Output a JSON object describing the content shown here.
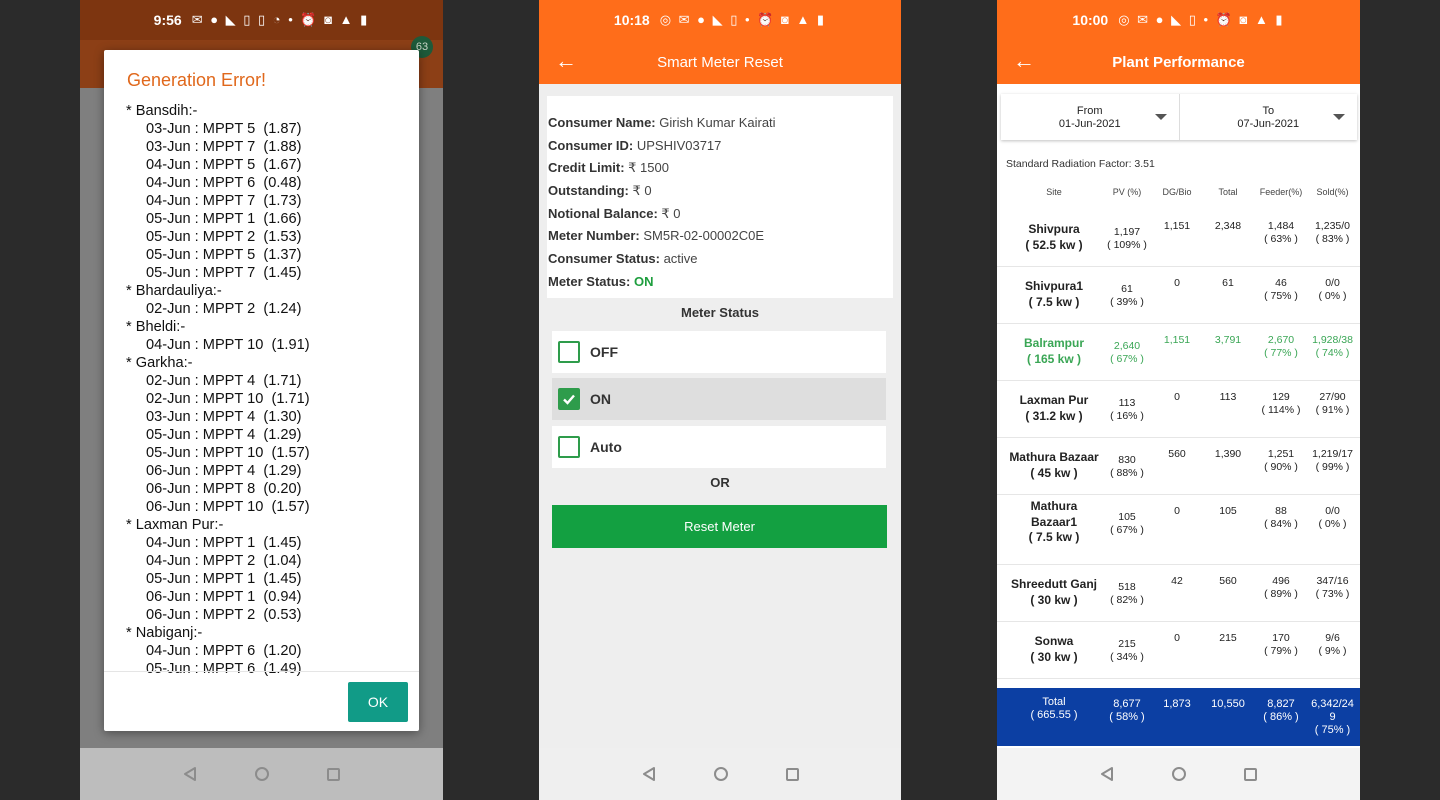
{
  "phone1": {
    "status_time": "9:56",
    "badge": "63",
    "dialog": {
      "title": "Generation Error!",
      "ok_label": "OK",
      "sections": [
        {
          "site": "* Bansdih:-",
          "entries": [
            "03-Jun : MPPT 5  (1.87)",
            "03-Jun : MPPT 7  (1.88)",
            "04-Jun : MPPT 5  (1.67)",
            "04-Jun : MPPT 6  (0.48)",
            "04-Jun : MPPT 7  (1.73)",
            "05-Jun : MPPT 1  (1.66)",
            "05-Jun : MPPT 2  (1.53)",
            "05-Jun : MPPT 5  (1.37)",
            "05-Jun : MPPT 7  (1.45)"
          ]
        },
        {
          "site": "* Bhardauliya:-",
          "entries": [
            "02-Jun : MPPT 2  (1.24)"
          ]
        },
        {
          "site": "* Bheldi:-",
          "entries": [
            "04-Jun : MPPT 10  (1.91)"
          ]
        },
        {
          "site": "* Garkha:-",
          "entries": [
            "02-Jun : MPPT 4  (1.71)",
            "02-Jun : MPPT 10  (1.71)",
            "03-Jun : MPPT 4  (1.30)",
            "05-Jun : MPPT 4  (1.29)",
            "05-Jun : MPPT 10  (1.57)",
            "06-Jun : MPPT 4  (1.29)",
            "06-Jun : MPPT 8  (0.20)",
            "06-Jun : MPPT 10  (1.57)"
          ]
        },
        {
          "site": "* Laxman Pur:-",
          "entries": [
            "04-Jun : MPPT 1  (1.45)",
            "04-Jun : MPPT 2  (1.04)",
            "05-Jun : MPPT 1  (1.45)",
            "06-Jun : MPPT 1  (0.94)",
            "06-Jun : MPPT 2  (0.53)"
          ]
        },
        {
          "site": "* Nabiganj:-",
          "entries": [
            "04-Jun : MPPT 6  (1.20)",
            "05-Jun : MPPT 6  (1.49)"
          ]
        }
      ]
    }
  },
  "phone2": {
    "status_time": "10:18",
    "title": "Smart Meter Reset",
    "info": [
      {
        "label": "Consumer Name:",
        "value": " Girish Kumar  Kairati"
      },
      {
        "label": "Consumer ID:",
        "value": " UPSHIV03717"
      },
      {
        "label": "Credit Limit:",
        "value": " ₹ 1500"
      },
      {
        "label": "Outstanding:",
        "value": " ₹ 0"
      },
      {
        "label": "Notional Balance:",
        "value": " ₹ 0"
      },
      {
        "label": "Meter Number:",
        "value": " SM5R-02-00002C0E"
      },
      {
        "label": "Consumer Status:",
        "value": " active"
      },
      {
        "label": "Meter Status:",
        "value": " ON"
      }
    ],
    "meter_status_title": "Meter Status",
    "options": [
      {
        "label": "OFF",
        "checked": false
      },
      {
        "label": "ON",
        "checked": true
      },
      {
        "label": "Auto",
        "checked": false
      }
    ],
    "or_label": "OR",
    "reset_label": "Reset Meter",
    "accent": "#ff6d1a",
    "green": "#13a041"
  },
  "phone3": {
    "status_time": "10:00",
    "title": "Plant Performance",
    "from_label": "From",
    "from_value": "01-Jun-2021",
    "to_label": "To",
    "to_value": "07-Jun-2021",
    "srf": "Standard Radiation Factor: 3.51",
    "headers": {
      "site": "Site",
      "pv": "PV (%)",
      "dg": "DG/Bio",
      "total": "Total",
      "feeder": "Feeder(%)",
      "sold": "Sold(%)"
    },
    "rows": [
      {
        "site": [
          "Shivpura",
          "( 52.5 kw )"
        ],
        "pv": [
          "1,197",
          "( 109% )"
        ],
        "dg": "1,151",
        "total": "2,348",
        "feeder": [
          "1,484",
          "( 63% )"
        ],
        "sold": [
          "1,235/0",
          "( 83% )"
        ],
        "highlight": false
      },
      {
        "site": [
          "Shivpura1",
          "( 7.5 kw )"
        ],
        "pv": [
          "61",
          "( 39% )"
        ],
        "dg": "0",
        "total": "61",
        "feeder": [
          "46",
          "( 75% )"
        ],
        "sold": [
          "0/0",
          "( 0% )"
        ],
        "highlight": false
      },
      {
        "site": [
          "Balrampur",
          "( 165 kw )"
        ],
        "pv": [
          "2,640",
          "( 67% )"
        ],
        "dg": "1,151",
        "total": "3,791",
        "feeder": [
          "2,670",
          "( 77% )"
        ],
        "sold": [
          "1,928/38",
          "( 74% )"
        ],
        "highlight": true
      },
      {
        "site": [
          "Laxman Pur",
          "( 31.2 kw )"
        ],
        "pv": [
          "113",
          "( 16% )"
        ],
        "dg": "0",
        "total": "113",
        "feeder": [
          "129",
          "( 114% )"
        ],
        "sold": [
          "27/90",
          "( 91% )"
        ],
        "highlight": false
      },
      {
        "site": [
          "Mathura Bazaar",
          "( 45 kw )"
        ],
        "pv": [
          "830",
          "( 88% )"
        ],
        "dg": "560",
        "total": "1,390",
        "feeder": [
          "1,251",
          "( 90% )"
        ],
        "sold": [
          "1,219/17",
          "( 99% )"
        ],
        "highlight": false
      },
      {
        "site": [
          "Mathura",
          "Bazaar1",
          "( 7.5 kw )"
        ],
        "pv": [
          "105",
          "( 67% )"
        ],
        "dg": "0",
        "total": "105",
        "feeder": [
          "88",
          "( 84% )"
        ],
        "sold": [
          "0/0",
          "( 0% )"
        ],
        "highlight": false
      },
      {
        "site": [
          "Shreedutt Ganj",
          "( 30 kw )"
        ],
        "pv": [
          "518",
          "( 82% )"
        ],
        "dg": "42",
        "total": "560",
        "feeder": [
          "496",
          "( 89% )"
        ],
        "sold": [
          "347/16",
          "( 73% )"
        ],
        "highlight": false
      },
      {
        "site": [
          "Sonwa",
          "( 30 kw )"
        ],
        "pv": [
          "215",
          "( 34% )"
        ],
        "dg": "0",
        "total": "215",
        "feeder": [
          "170",
          "( 79% )"
        ],
        "sold": [
          "9/6",
          "( 9% )"
        ],
        "highlight": false
      }
    ],
    "total": {
      "site": [
        "Total",
        "( 665.55 )"
      ],
      "pv": [
        "8,677",
        "( 58% )"
      ],
      "dg": "1,873",
      "total": "10,550",
      "feeder": [
        "8,827",
        "( 86% )"
      ],
      "sold": [
        "6,342/24",
        "9",
        "( 75% )"
      ]
    },
    "total_bg": "#0c3fa3"
  }
}
